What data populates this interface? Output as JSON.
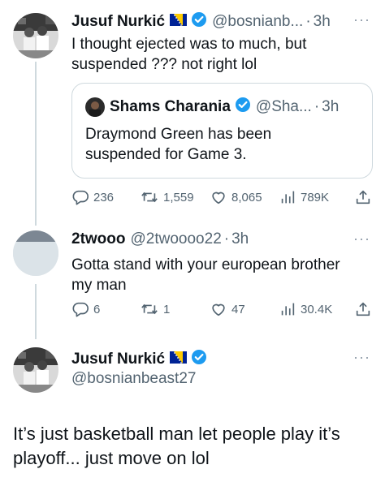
{
  "colors": {
    "text": "#0f1419",
    "secondary": "#536471",
    "verified_blue": "#1d9bf0",
    "thread_line": "#cfd9de"
  },
  "reply1": {
    "name": "Jusuf Nurkić",
    "handle": "@bosnianb...",
    "time": "3h",
    "text_line1": "I thought ejected was to much, but",
    "text_line2": "suspended ??? not right lol",
    "quote": {
      "name": "Shams Charania",
      "handle": "@Sha...",
      "time": "3h",
      "text_line1": "Draymond Green has been",
      "text_line2": "suspended for Game 3."
    },
    "stats": {
      "replies": "236",
      "reposts": "1,559",
      "likes": "8,065",
      "views": "789K"
    }
  },
  "reply2": {
    "name": "2twooo",
    "handle": "@2twoooo22",
    "time": "3h",
    "text_line1": "Gotta stand with your european brother",
    "text_line2": "my man",
    "stats": {
      "replies": "6",
      "reposts": "1",
      "likes": "47",
      "views": "30.4K"
    }
  },
  "main": {
    "name": "Jusuf Nurkić",
    "handle": "@bosnianbeast27",
    "text_line1": "It’s just basketball man let people play it’s",
    "text_line2": "playoff...  just move on lol"
  },
  "ui": {
    "dot": "·",
    "more": "···"
  },
  "icons": {
    "flag": "bosnia-flag-icon",
    "verified": "verified-badge-icon",
    "reply": "reply-icon",
    "repost": "repost-icon",
    "like": "heart-icon",
    "views": "views-icon",
    "share": "share-icon"
  }
}
